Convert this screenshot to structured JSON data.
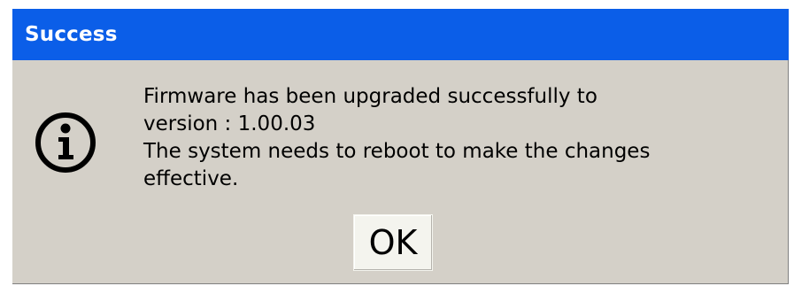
{
  "dialog": {
    "title": "Success",
    "icon": "info-icon",
    "message_lines": [
      "Firmware has been upgraded successfully to",
      "version : 1.00.03",
      "The system needs to reboot to make the changes",
      "effective."
    ],
    "ok_label": "OK"
  },
  "colors": {
    "title_bar": "#0b5ee8",
    "dialog_background": "#d4d0c8",
    "button_background": "#f4f4ee"
  }
}
